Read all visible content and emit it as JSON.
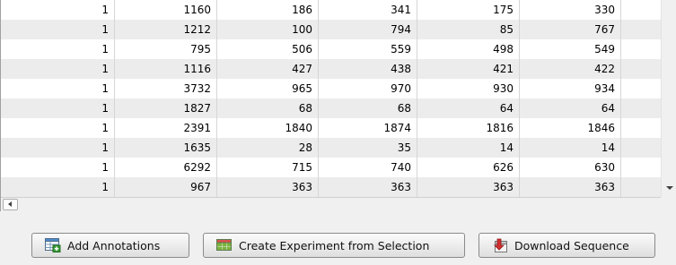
{
  "table": {
    "rows": [
      [
        "1",
        "1160",
        "186",
        "341",
        "175",
        "330",
        ""
      ],
      [
        "1",
        "1212",
        "100",
        "794",
        "85",
        "767",
        ""
      ],
      [
        "1",
        "795",
        "506",
        "559",
        "498",
        "549",
        ""
      ],
      [
        "1",
        "1116",
        "427",
        "438",
        "421",
        "422",
        ""
      ],
      [
        "1",
        "3732",
        "965",
        "970",
        "930",
        "934",
        ""
      ],
      [
        "1",
        "1827",
        "68",
        "68",
        "64",
        "64",
        ""
      ],
      [
        "1",
        "2391",
        "1840",
        "1874",
        "1816",
        "1846",
        ""
      ],
      [
        "1",
        "1635",
        "28",
        "35",
        "14",
        "14",
        ""
      ],
      [
        "1",
        "6292",
        "715",
        "740",
        "626",
        "630",
        ""
      ],
      [
        "1",
        "967",
        "363",
        "363",
        "363",
        "363",
        ""
      ]
    ]
  },
  "buttons": {
    "add_annotations": "Add Annotations",
    "create_experiment": "Create Experiment from Selection",
    "download_sequence": "Download Sequence"
  },
  "icons": {
    "add_annotations": "table-plus-icon",
    "create_experiment": "grid-table-icon",
    "download_sequence": "download-dna-icon"
  }
}
